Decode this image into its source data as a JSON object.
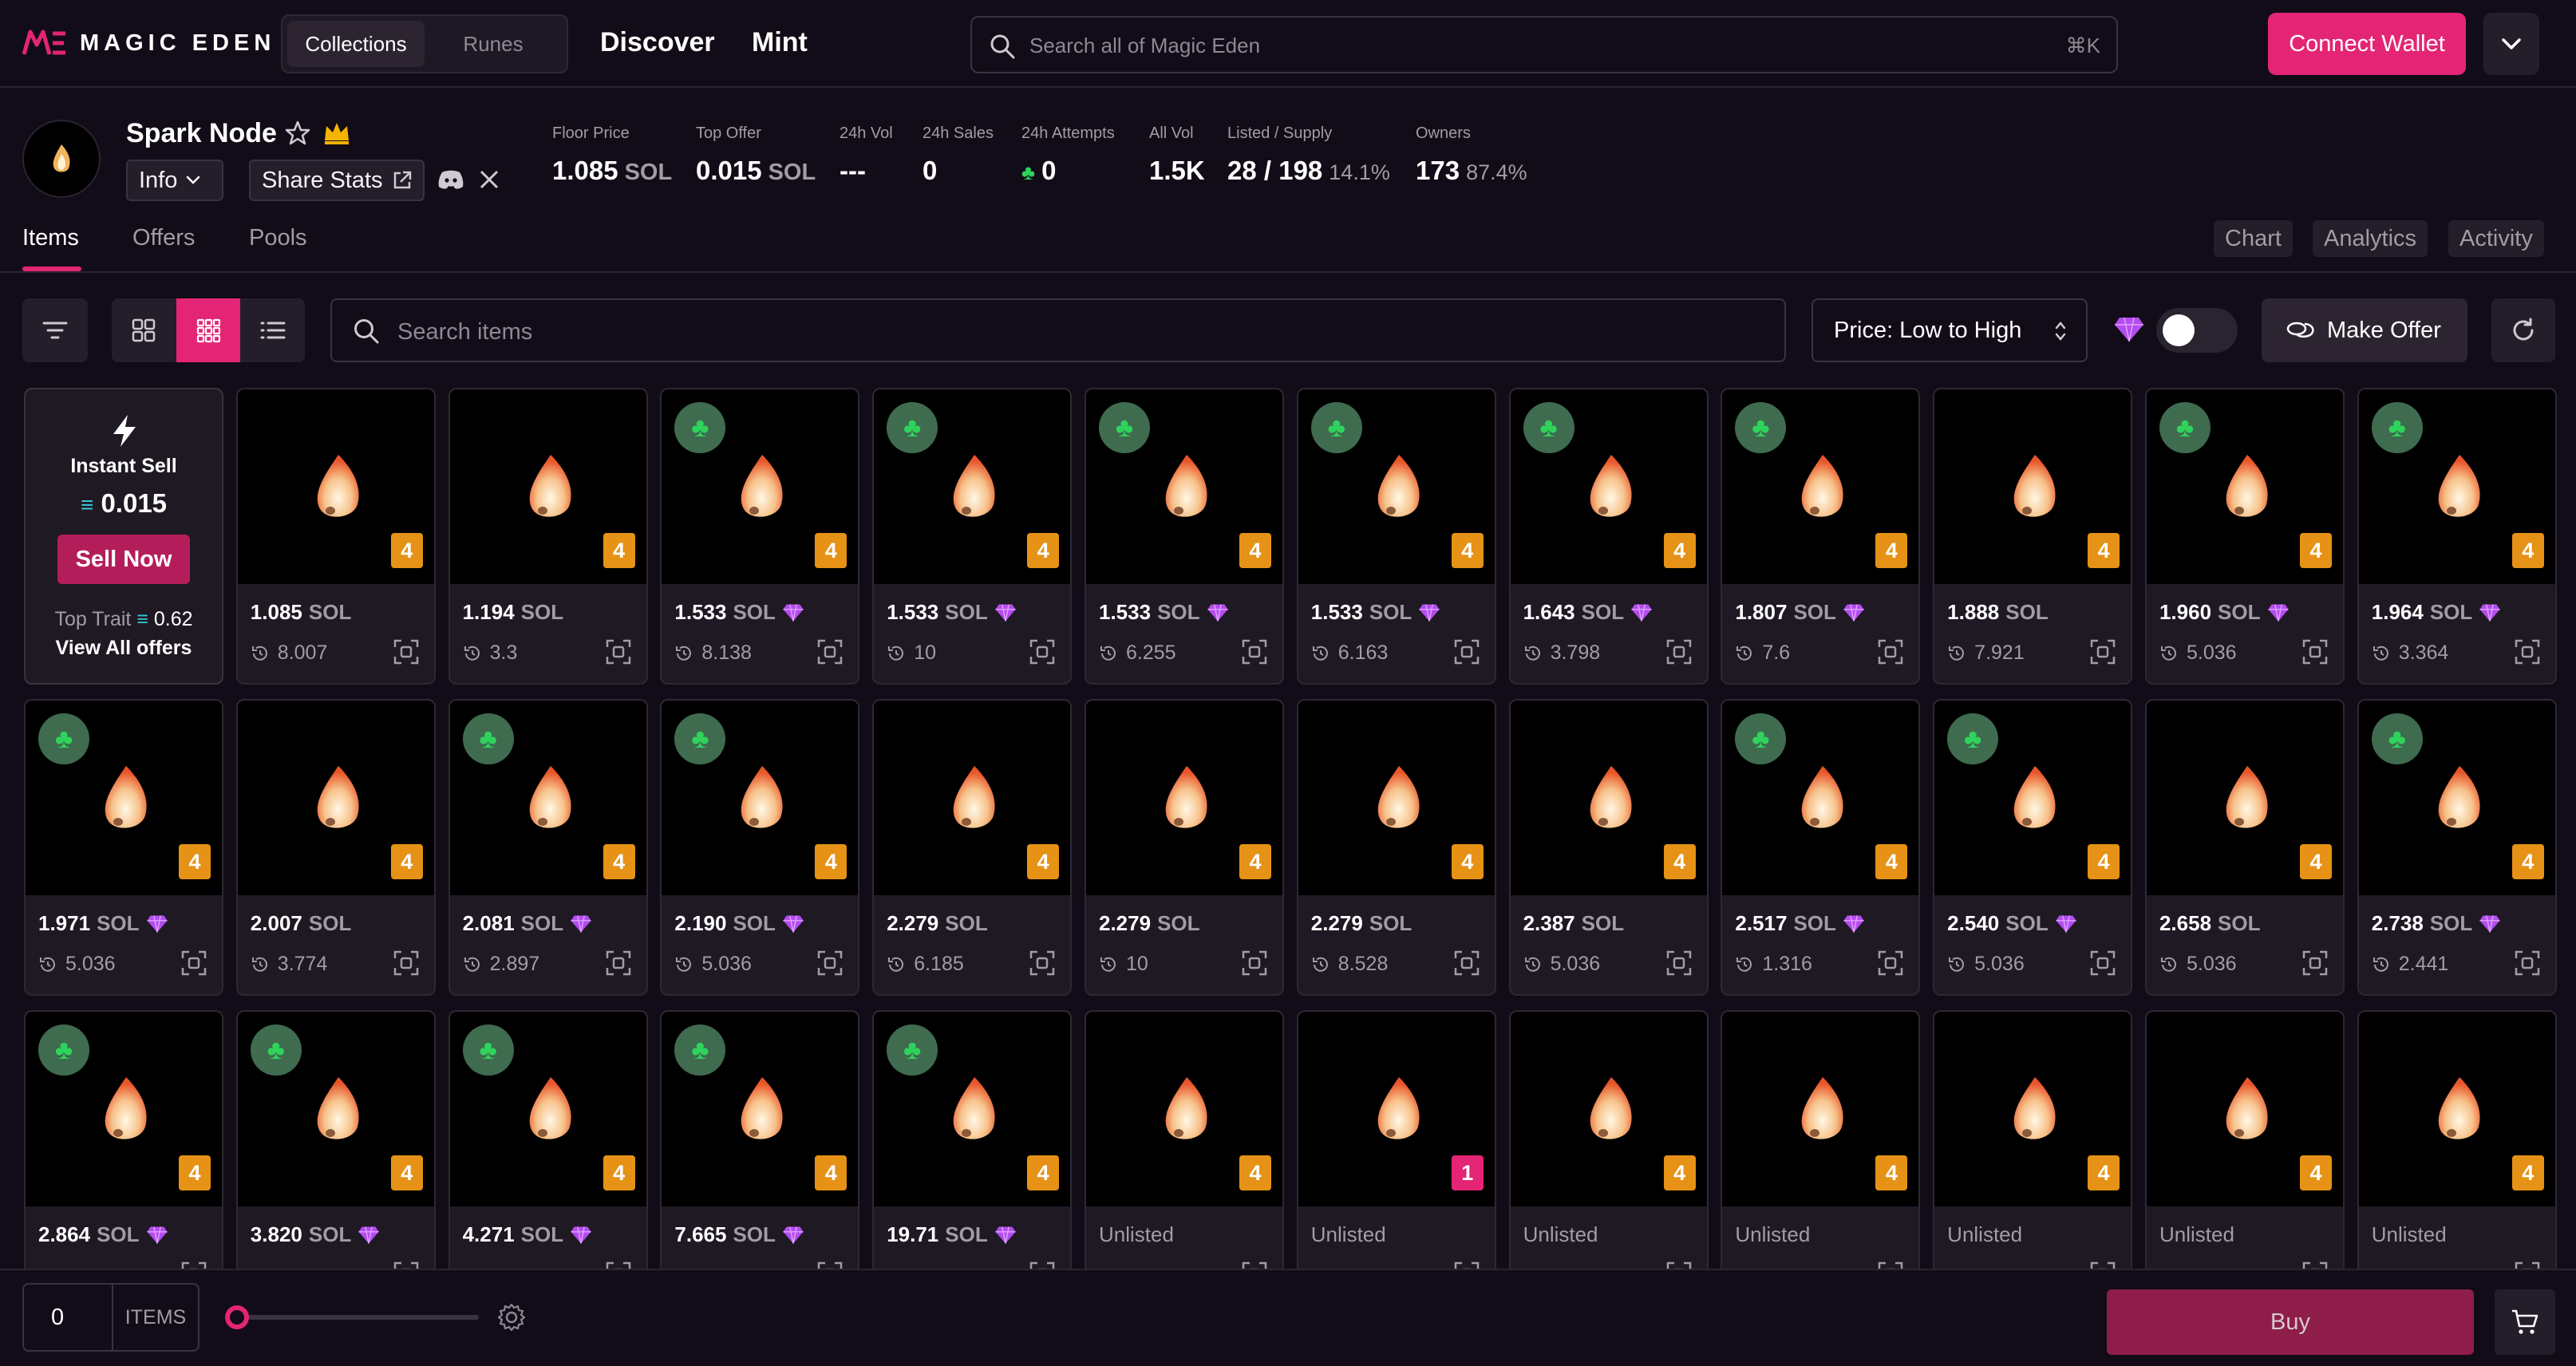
{
  "brand": {
    "name": "MAGIC EDEN"
  },
  "nav": {
    "segments": [
      {
        "label": "Collections",
        "active": true
      },
      {
        "label": "Runes",
        "active": false
      }
    ],
    "discover": "Discover",
    "mint": "Mint",
    "search_placeholder": "Search all of Magic Eden",
    "search_shortcut": "⌘K",
    "connect_wallet": "Connect Wallet"
  },
  "collection": {
    "name": "Spark Node",
    "info_label": "Info",
    "share_label": "Share Stats",
    "stats": [
      {
        "label": "Floor Price",
        "value": "1.085",
        "unit": "SOL",
        "extra": ""
      },
      {
        "label": "Top Offer",
        "value": "0.015",
        "unit": "SOL",
        "extra": ""
      },
      {
        "label": "24h Vol",
        "value": "---",
        "unit": "",
        "extra": ""
      },
      {
        "label": "24h Sales",
        "value": "0",
        "unit": "",
        "extra": ""
      },
      {
        "label": "24h Attempts",
        "value": "0",
        "unit": "",
        "extra": ""
      },
      {
        "label": "All Vol",
        "value": "1.5K",
        "unit": "",
        "extra": ""
      },
      {
        "label": "Listed / Supply",
        "value": "28 / 198",
        "unit": "",
        "extra": "14.1%"
      },
      {
        "label": "Owners",
        "value": "173",
        "unit": "",
        "extra": "87.4%"
      }
    ]
  },
  "tabs": {
    "items": "Items",
    "offers": "Offers",
    "pools": "Pools",
    "chart": "Chart",
    "analytics": "Analytics",
    "activity": "Activity"
  },
  "toolbar": {
    "search_placeholder": "Search items",
    "sort_label": "Price: Low to High",
    "make_offer": "Make Offer",
    "hide_rare_toggle": false
  },
  "instant_sell": {
    "title": "Instant Sell",
    "amount": "0.015",
    "button": "Sell Now",
    "top_trait_label": "Top Trait",
    "top_trait_value": "0.62",
    "view_all": "View All offers"
  },
  "cards": [
    {
      "price": "1.085",
      "unit": "SOL",
      "gem": false,
      "clover": false,
      "badge": "4",
      "meta": "8.007"
    },
    {
      "price": "1.194",
      "unit": "SOL",
      "gem": false,
      "clover": false,
      "badge": "4",
      "meta": "3.3"
    },
    {
      "price": "1.533",
      "unit": "SOL",
      "gem": true,
      "clover": true,
      "badge": "4",
      "meta": "8.138"
    },
    {
      "price": "1.533",
      "unit": "SOL",
      "gem": true,
      "clover": true,
      "badge": "4",
      "meta": "10"
    },
    {
      "price": "1.533",
      "unit": "SOL",
      "gem": true,
      "clover": true,
      "badge": "4",
      "meta": "6.255"
    },
    {
      "price": "1.533",
      "unit": "SOL",
      "gem": true,
      "clover": true,
      "badge": "4",
      "meta": "6.163"
    },
    {
      "price": "1.643",
      "unit": "SOL",
      "gem": true,
      "clover": true,
      "badge": "4",
      "meta": "3.798"
    },
    {
      "price": "1.807",
      "unit": "SOL",
      "gem": true,
      "clover": true,
      "badge": "4",
      "meta": "7.6"
    },
    {
      "price": "1.888",
      "unit": "SOL",
      "gem": false,
      "clover": false,
      "badge": "4",
      "meta": "7.921"
    },
    {
      "price": "1.960",
      "unit": "SOL",
      "gem": true,
      "clover": true,
      "badge": "4",
      "meta": "5.036"
    },
    {
      "price": "1.964",
      "unit": "SOL",
      "gem": true,
      "clover": true,
      "badge": "4",
      "meta": "3.364"
    },
    {
      "price": "1.971",
      "unit": "SOL",
      "gem": true,
      "clover": true,
      "badge": "4",
      "meta": "5.036"
    },
    {
      "price": "2.007",
      "unit": "SOL",
      "gem": false,
      "clover": false,
      "badge": "4",
      "meta": "3.774"
    },
    {
      "price": "2.081",
      "unit": "SOL",
      "gem": true,
      "clover": true,
      "badge": "4",
      "meta": "2.897"
    },
    {
      "price": "2.190",
      "unit": "SOL",
      "gem": true,
      "clover": true,
      "badge": "4",
      "meta": "5.036"
    },
    {
      "price": "2.279",
      "unit": "SOL",
      "gem": false,
      "clover": false,
      "badge": "4",
      "meta": "6.185"
    },
    {
      "price": "2.279",
      "unit": "SOL",
      "gem": false,
      "clover": false,
      "badge": "4",
      "meta": "10"
    },
    {
      "price": "2.279",
      "unit": "SOL",
      "gem": false,
      "clover": false,
      "badge": "4",
      "meta": "8.528"
    },
    {
      "price": "2.387",
      "unit": "SOL",
      "gem": false,
      "clover": false,
      "badge": "4",
      "meta": "5.036"
    },
    {
      "price": "2.517",
      "unit": "SOL",
      "gem": true,
      "clover": true,
      "badge": "4",
      "meta": "1.316"
    },
    {
      "price": "2.540",
      "unit": "SOL",
      "gem": true,
      "clover": true,
      "badge": "4",
      "meta": "5.036"
    },
    {
      "price": "2.658",
      "unit": "SOL",
      "gem": false,
      "clover": false,
      "badge": "4",
      "meta": "5.036"
    },
    {
      "price": "2.738",
      "unit": "SOL",
      "gem": true,
      "clover": true,
      "badge": "4",
      "meta": "2.441"
    },
    {
      "price": "2.864",
      "unit": "SOL",
      "gem": true,
      "clover": true,
      "badge": "4",
      "meta": ""
    },
    {
      "price": "3.820",
      "unit": "SOL",
      "gem": true,
      "clover": true,
      "badge": "4",
      "meta": ""
    },
    {
      "price": "4.271",
      "unit": "SOL",
      "gem": true,
      "clover": true,
      "badge": "4",
      "meta": ""
    },
    {
      "price": "7.665",
      "unit": "SOL",
      "gem": true,
      "clover": true,
      "badge": "4",
      "meta": ""
    },
    {
      "price": "19.71",
      "unit": "SOL",
      "gem": true,
      "clover": true,
      "badge": "4",
      "meta": ""
    },
    {
      "price": "Unlisted",
      "unit": "",
      "gem": false,
      "clover": false,
      "badge": "4",
      "meta": ""
    },
    {
      "price": "Unlisted",
      "unit": "",
      "gem": false,
      "clover": false,
      "badge": "1",
      "meta": ""
    },
    {
      "price": "Unlisted",
      "unit": "",
      "gem": false,
      "clover": false,
      "badge": "4",
      "meta": ""
    },
    {
      "price": "Unlisted",
      "unit": "",
      "gem": false,
      "clover": false,
      "badge": "4",
      "meta": ""
    },
    {
      "price": "Unlisted",
      "unit": "",
      "gem": false,
      "clover": false,
      "badge": "4",
      "meta": ""
    },
    {
      "price": "Unlisted",
      "unit": "",
      "gem": false,
      "clover": false,
      "badge": "4",
      "meta": ""
    },
    {
      "price": "Unlisted",
      "unit": "",
      "gem": false,
      "clover": false,
      "badge": "4",
      "meta": ""
    }
  ],
  "bottom": {
    "quantity": "0",
    "items_label": "ITEMS",
    "buy_label": "Buy"
  },
  "colors": {
    "accent": "#e42575",
    "badge": "#e69216",
    "gem": "#b44cf0",
    "clover": "#2fd35c"
  }
}
